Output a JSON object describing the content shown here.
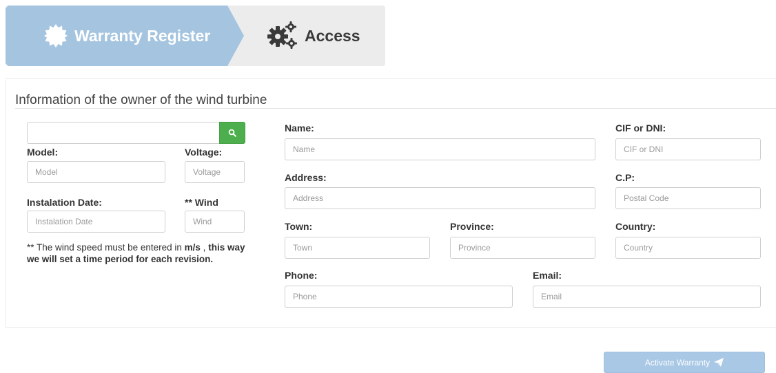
{
  "tabs": {
    "warranty_register": "Warranty Register",
    "access": "Access",
    "active_color": "#a4c4e0",
    "inactive_color": "#ececec"
  },
  "section": {
    "title": "Information of the owner of the wind turbine"
  },
  "search": {
    "value": "",
    "button_icon": "search-icon",
    "button_color": "#4cae4c"
  },
  "left": {
    "model_label": "Model:",
    "model_placeholder": "Model",
    "voltage_label": "Voltage:",
    "voltage_placeholder": "Voltage",
    "installation_date_label": "Instalation Date:",
    "installation_date_placeholder": "Instalation Date",
    "wind_label": "** Wind",
    "wind_placeholder": "Wind",
    "note_prefix": "** The wind speed must be entered in ",
    "note_unit": "m/s",
    "note_suffix": " ,",
    "note_bold": "this way we will set a time period for each revision."
  },
  "owner": {
    "name_label": "Name:",
    "name_placeholder": "Name",
    "cif_label": "CIF or DNI:",
    "cif_placeholder": "CIF or DNI",
    "address_label": "Address:",
    "address_placeholder": "Address",
    "cp_label": "C.P:",
    "cp_placeholder": "Postal Code",
    "town_label": "Town:",
    "town_placeholder": "Town",
    "province_label": "Province:",
    "province_placeholder": "Province",
    "country_label": "Country:",
    "country_placeholder": "Country",
    "phone_label": "Phone:",
    "phone_placeholder": "Phone",
    "email_label": "Email:",
    "email_placeholder": "Email"
  },
  "actions": {
    "activate_label": "Activate Warranty",
    "activate_icon": "paper-plane-icon",
    "activate_color": "#a9c8e6"
  }
}
